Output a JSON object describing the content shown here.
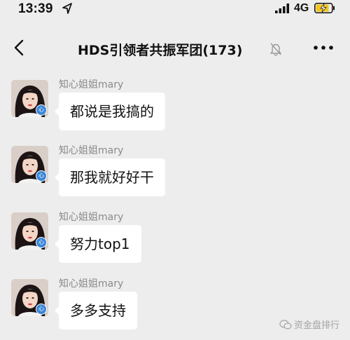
{
  "status_bar": {
    "time": "13:39",
    "network": "4G",
    "icons": [
      "location-arrow-icon",
      "signal-icon",
      "battery-charging-icon"
    ]
  },
  "nav": {
    "back_icon": "chevron-left-icon",
    "title": "HDS引领者共振军团(173)",
    "mute_icon": "bell-muted-icon",
    "more_icon": "more-dots-icon"
  },
  "messages": [
    {
      "sender": "知心姐姐mary",
      "text": "都说是我搞的"
    },
    {
      "sender": "知心姐姐mary",
      "text": "那我就好好干"
    },
    {
      "sender": "知心姐姐mary",
      "text": "努力top1"
    },
    {
      "sender": "知心姐姐mary",
      "text": "多多支持"
    }
  ],
  "avatar_badge": "心",
  "watermark": "资金盘排行",
  "colors": {
    "background": "#ededed",
    "bubble": "#ffffff",
    "sender_text": "#8a8a8a",
    "badge": "#3a86d8"
  }
}
